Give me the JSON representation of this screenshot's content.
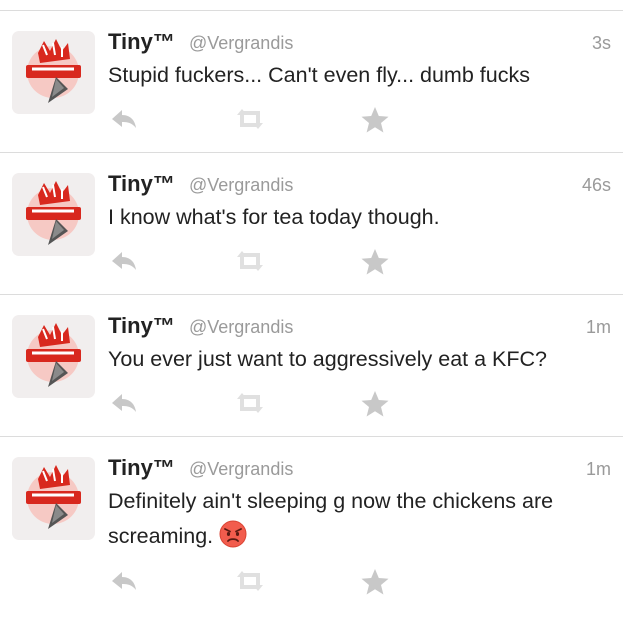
{
  "tweets": [
    {
      "name": "Tiny™",
      "handle": "@Vergrandis",
      "time": "3s",
      "text": "Stupid fuckers... Can't even fly... dumb fucks",
      "emoji": ""
    },
    {
      "name": "Tiny™",
      "handle": "@Vergrandis",
      "time": "46s",
      "text": "I know what's for tea today though.",
      "emoji": ""
    },
    {
      "name": "Tiny™",
      "handle": "@Vergrandis",
      "time": "1m",
      "text": "You ever just want to aggressively eat a KFC?",
      "emoji": ""
    },
    {
      "name": "Tiny™",
      "handle": "@Vergrandis",
      "time": "1m",
      "text": "Definitely ain't sleeping g now the chickens are screaming.",
      "emoji": "angry-face"
    }
  ],
  "icons": {
    "reply": "reply-icon",
    "retweet": "retweet-icon",
    "favorite": "star-icon"
  },
  "colors": {
    "name": "#222222",
    "meta": "#9a9a9a",
    "icon": "#c8c8c8",
    "divider": "#dcdcdc"
  }
}
